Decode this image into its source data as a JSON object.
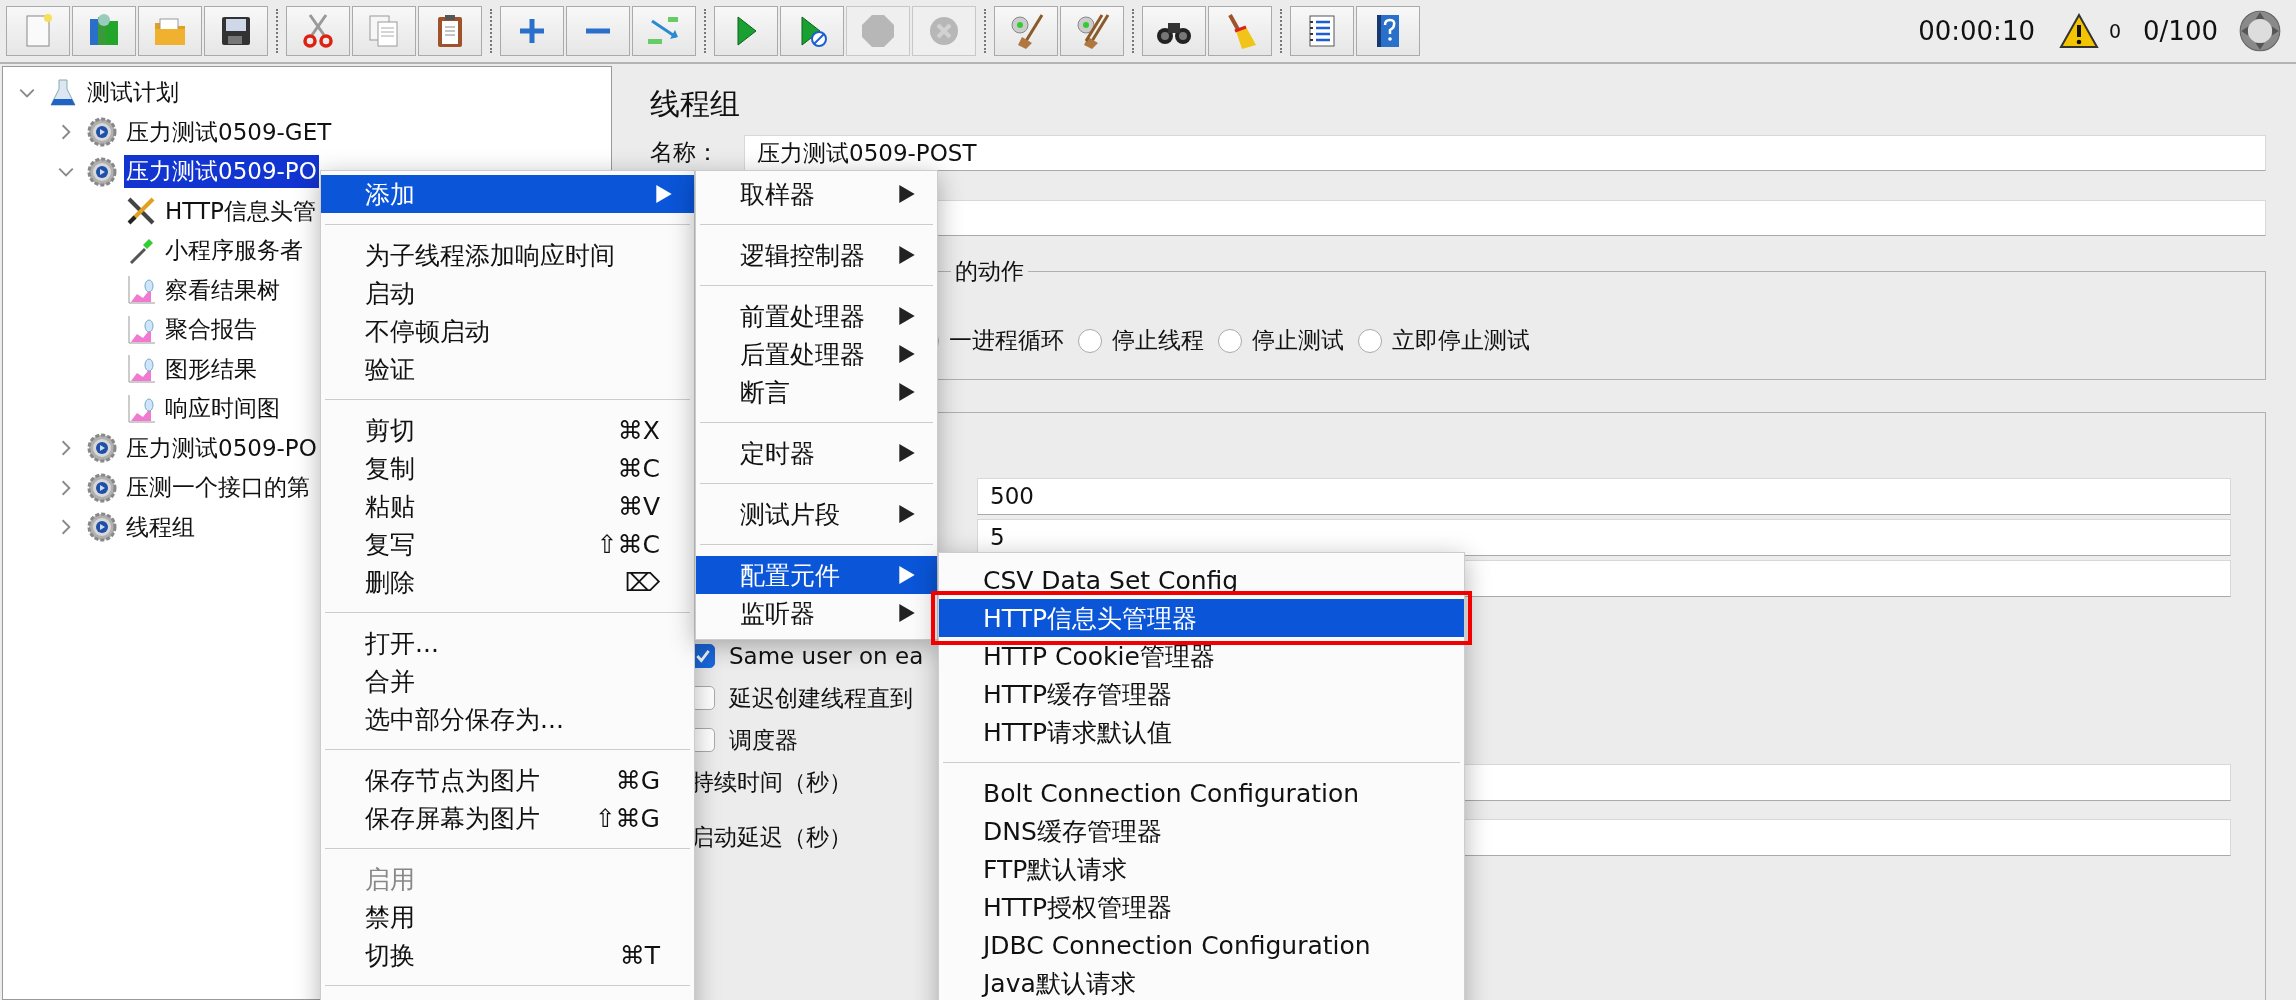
{
  "toolbar": [
    {
      "buttons": [
        {
          "kind": "new",
          "disabled": false
        },
        {
          "kind": "templates",
          "disabled": false
        },
        {
          "kind": "open",
          "disabled": false
        },
        {
          "kind": "save",
          "disabled": false
        }
      ]
    },
    {
      "buttons": [
        {
          "kind": "cut",
          "disabled": false
        },
        {
          "kind": "copy",
          "disabled": false
        },
        {
          "kind": "paste",
          "disabled": false
        }
      ]
    },
    {
      "buttons": [
        {
          "kind": "expand",
          "disabled": false
        },
        {
          "kind": "collapse",
          "disabled": false
        },
        {
          "kind": "toggle",
          "disabled": false
        }
      ]
    },
    {
      "buttons": [
        {
          "kind": "start",
          "disabled": false
        },
        {
          "kind": "start-no-pause",
          "disabled": false
        },
        {
          "kind": "stop",
          "disabled": true
        },
        {
          "kind": "shutdown",
          "disabled": true
        }
      ]
    },
    {
      "buttons": [
        {
          "kind": "clear",
          "disabled": false
        },
        {
          "kind": "clear-all",
          "disabled": false
        }
      ]
    },
    {
      "buttons": [
        {
          "kind": "search",
          "disabled": false
        },
        {
          "kind": "reset-search",
          "disabled": false
        }
      ]
    },
    {
      "buttons": [
        {
          "kind": "functions",
          "disabled": false
        },
        {
          "kind": "help",
          "disabled": false
        }
      ]
    }
  ],
  "status": {
    "elapsed": "00:00:10",
    "warnings": "0",
    "threads": "0/100"
  },
  "tree": [
    {
      "label": "测试计划",
      "kind": "plan",
      "expanded": true,
      "selected": false,
      "children": [
        {
          "label": "压力测试0509-GET",
          "kind": "thread-group",
          "expanded": false,
          "selected": false
        },
        {
          "label": "压力测试0509-PO",
          "kind": "thread-group",
          "expanded": true,
          "selected": true,
          "children": [
            {
              "label": "HTTP信息头管",
              "kind": "config",
              "selected": false
            },
            {
              "label": "小程序服务者",
              "kind": "preprocessor",
              "selected": false
            },
            {
              "label": "察看结果树",
              "kind": "listener",
              "selected": false
            },
            {
              "label": "聚合报告",
              "kind": "listener",
              "selected": false
            },
            {
              "label": "图形结果",
              "kind": "listener",
              "selected": false
            },
            {
              "label": "响应时间图",
              "kind": "listener",
              "selected": false
            }
          ]
        },
        {
          "label": "压力测试0509-PO",
          "kind": "thread-group",
          "expanded": false,
          "selected": false
        },
        {
          "label": "压测一个接口的第",
          "kind": "thread-group",
          "expanded": false,
          "selected": false
        },
        {
          "label": "线程组",
          "kind": "thread-group",
          "expanded": false,
          "selected": false
        }
      ]
    }
  ],
  "panel": {
    "title": "线程组",
    "name_label": "名称：",
    "name_value": "压力测试0509-POST",
    "error_action": {
      "legend": "的动作",
      "options": [
        {
          "label": "一进程循环",
          "selected": false
        },
        {
          "label": "停止线程",
          "selected": false
        },
        {
          "label": "停止测试",
          "selected": false
        },
        {
          "label": "立即停止测试",
          "selected": false
        }
      ]
    },
    "thread_fields": [
      {
        "value": "500"
      },
      {
        "value": "5"
      },
      {
        "kind": "empty"
      }
    ],
    "checkboxes": [
      {
        "label": "Same user on ea",
        "checked": true
      },
      {
        "label": "延迟创建线程直到",
        "checked": false
      },
      {
        "label": "调度器",
        "checked": false
      }
    ],
    "timing_fields": [
      {
        "label": "持续时间（秒）"
      },
      {
        "label": "启动延迟（秒）"
      }
    ]
  },
  "context_menu": [
    {
      "kind": "submenu",
      "label": "添加",
      "selected": true
    },
    {
      "kind": "separator"
    },
    {
      "kind": "item",
      "label": "为子线程添加响应时间",
      "selected": false,
      "disabled": false
    },
    {
      "kind": "item",
      "label": "启动",
      "selected": false,
      "disabled": false
    },
    {
      "kind": "item",
      "label": "不停顿启动",
      "selected": false,
      "disabled": false
    },
    {
      "kind": "item",
      "label": "验证",
      "selected": false,
      "disabled": false
    },
    {
      "kind": "separator"
    },
    {
      "kind": "item",
      "label": "剪切",
      "shortcut": "⌘X",
      "selected": false,
      "disabled": false
    },
    {
      "kind": "item",
      "label": "复制",
      "shortcut": "⌘C",
      "selected": false,
      "disabled": false
    },
    {
      "kind": "item",
      "label": "粘贴",
      "shortcut": "⌘V",
      "selected": false,
      "disabled": false
    },
    {
      "kind": "item",
      "label": "复写",
      "shortcut": "⇧⌘C",
      "selected": false,
      "disabled": false
    },
    {
      "kind": "item",
      "label": "删除",
      "shortcut": "⌦",
      "selected": false,
      "disabled": false
    },
    {
      "kind": "separator"
    },
    {
      "kind": "item",
      "label": "打开...",
      "selected": false,
      "disabled": false
    },
    {
      "kind": "item",
      "label": "合并",
      "selected": false,
      "disabled": false
    },
    {
      "kind": "item",
      "label": "选中部分保存为...",
      "selected": false,
      "disabled": false
    },
    {
      "kind": "separator"
    },
    {
      "kind": "item",
      "label": "保存节点为图片",
      "shortcut": "⌘G",
      "selected": false,
      "disabled": false
    },
    {
      "kind": "item",
      "label": "保存屏幕为图片",
      "shortcut": "⇧⌘G",
      "selected": false,
      "disabled": false
    },
    {
      "kind": "separator"
    },
    {
      "kind": "item",
      "label": "启用",
      "selected": false,
      "disabled": true
    },
    {
      "kind": "item",
      "label": "禁用",
      "selected": false,
      "disabled": false
    },
    {
      "kind": "item",
      "label": "切换",
      "shortcut": "⌘T",
      "selected": false,
      "disabled": false
    },
    {
      "kind": "separator"
    }
  ],
  "add_menu": [
    {
      "kind": "submenu",
      "label": "取样器",
      "selected": false
    },
    {
      "kind": "separator"
    },
    {
      "kind": "submenu",
      "label": "逻辑控制器",
      "selected": false
    },
    {
      "kind": "separator"
    },
    {
      "kind": "submenu",
      "label": "前置处理器",
      "selected": false
    },
    {
      "kind": "submenu",
      "label": "后置处理器",
      "selected": false
    },
    {
      "kind": "submenu",
      "label": "断言",
      "selected": false
    },
    {
      "kind": "separator"
    },
    {
      "kind": "submenu",
      "label": "定时器",
      "selected": false
    },
    {
      "kind": "separator"
    },
    {
      "kind": "submenu",
      "label": "测试片段",
      "selected": false
    },
    {
      "kind": "separator"
    },
    {
      "kind": "submenu",
      "label": "配置元件",
      "selected": true
    },
    {
      "kind": "submenu",
      "label": "监听器",
      "selected": false
    }
  ],
  "config_menu": [
    {
      "kind": "item",
      "label": "CSV Data Set Config",
      "selected": false,
      "outlined": false
    },
    {
      "kind": "item",
      "label": "HTTP信息头管理器",
      "selected": true,
      "outlined": true
    },
    {
      "kind": "item",
      "label": "HTTP Cookie管理器",
      "selected": false,
      "outlined": false
    },
    {
      "kind": "item",
      "label": "HTTP缓存管理器",
      "selected": false,
      "outlined": false
    },
    {
      "kind": "item",
      "label": "HTTP请求默认值",
      "selected": false,
      "outlined": false
    },
    {
      "kind": "separator"
    },
    {
      "kind": "item",
      "label": "Bolt Connection Configuration",
      "selected": false,
      "outlined": false
    },
    {
      "kind": "item",
      "label": "DNS缓存管理器",
      "selected": false,
      "outlined": false
    },
    {
      "kind": "item",
      "label": "FTP默认请求",
      "selected": false,
      "outlined": false
    },
    {
      "kind": "item",
      "label": "HTTP授权管理器",
      "selected": false,
      "outlined": false
    },
    {
      "kind": "item",
      "label": "JDBC Connection Configuration",
      "selected": false,
      "outlined": false
    },
    {
      "kind": "item",
      "label": "Java默认请求",
      "selected": false,
      "outlined": false
    }
  ]
}
